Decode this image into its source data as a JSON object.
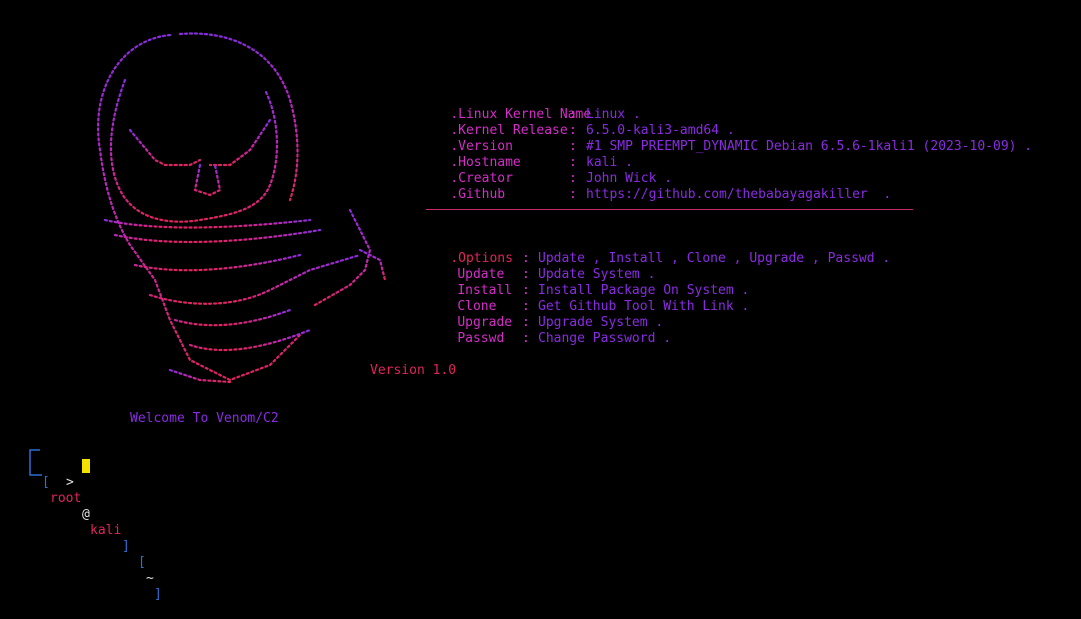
{
  "banner": {
    "info": [
      {
        "key": ".Linux Kernel Name",
        "sep": ":",
        "value": "Linux ."
      },
      {
        "key": ".Kernel Release",
        "sep": ":",
        "value": "6.5.0-kali3-amd64 ."
      },
      {
        "key": ".Version",
        "sep": ":",
        "value": "#1 SMP PREEMPT_DYNAMIC Debian 6.5.6-1kali1 (2023-10-09) ."
      },
      {
        "key": ".Hostname",
        "sep": ":",
        "value": "kali ."
      },
      {
        "key": ".Creator",
        "sep": ":",
        "value": "John Wick ."
      },
      {
        "key": ".Github",
        "sep": ":",
        "value": "https://github.com/thebabayagakiller  ."
      }
    ],
    "options_title": ".Options",
    "options_list": "Update , Install , Clone , Upgrade , Passwd .",
    "commands": [
      {
        "name": "Update",
        "desc": "Update System ."
      },
      {
        "name": "Install",
        "desc": "Install Package On System ."
      },
      {
        "name": "Clone",
        "desc": "Get Github Tool With Link ."
      },
      {
        "name": "Upgrade",
        "desc": "Upgrade System ."
      },
      {
        "name": "Passwd",
        "desc": "Change Password ."
      }
    ],
    "version": "Version 1.0",
    "welcome": "Welcome To Venom/C2"
  },
  "prompt": {
    "user": "root",
    "at": "@",
    "host": "kali",
    "dir": "~",
    "arrow": ">"
  },
  "colors": {
    "background": "#000000",
    "key": "#d42dc8",
    "value": "#8a2be2",
    "accent_red": "#e0245e",
    "prompt_box": "#2f6fd6",
    "cursor": "#f5e100"
  }
}
